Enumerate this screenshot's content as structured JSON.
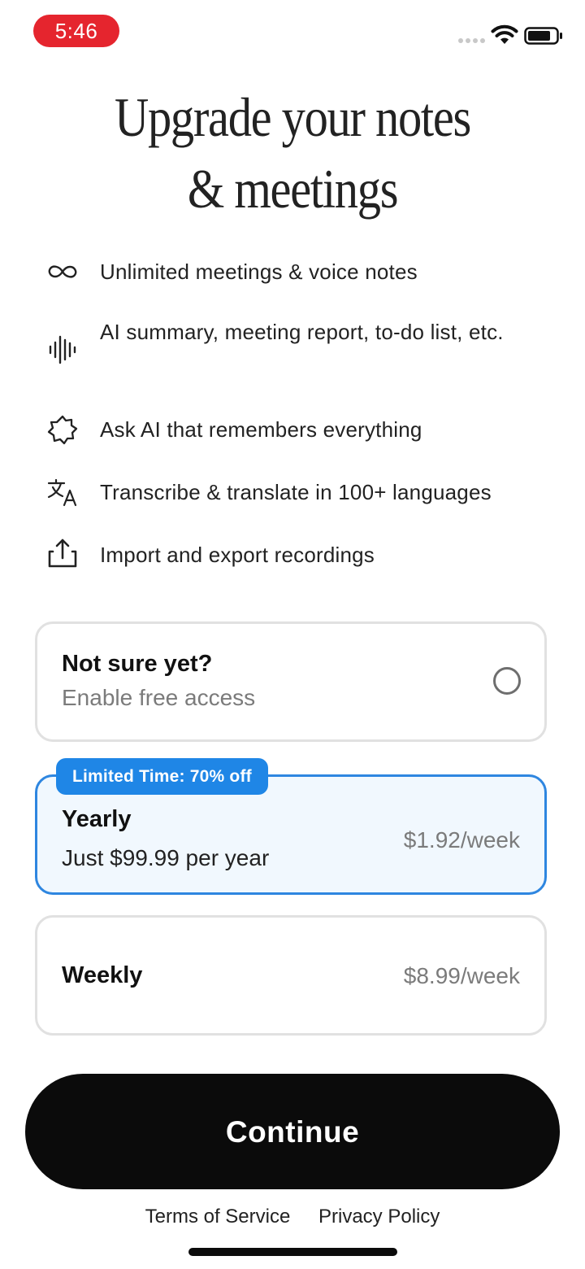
{
  "status_bar": {
    "time": "5:46"
  },
  "header": {
    "title_line1": "Upgrade your notes",
    "title_line2": "& meetings"
  },
  "features": [
    {
      "icon": "infinity-icon",
      "text": "Unlimited meetings & voice notes"
    },
    {
      "icon": "waveform-icon",
      "text": "AI summary, meeting report, to-do list, etc."
    },
    {
      "icon": "sparkle-badge-icon",
      "text": "Ask AI that remembers everything"
    },
    {
      "icon": "translate-icon",
      "text": "Transcribe & translate in 100+ languages"
    },
    {
      "icon": "share-upload-icon",
      "text": "Import and export recordings"
    }
  ],
  "plans": {
    "free": {
      "title": "Not sure yet?",
      "subtitle": "Enable free access",
      "selected": false
    },
    "yearly": {
      "badge": "Limited Time: 70% off",
      "title": "Yearly",
      "subtitle": "Just $99.99 per year",
      "price": "$1.92/week",
      "selected": true
    },
    "weekly": {
      "title": "Weekly",
      "price": "$8.99/week",
      "selected": false
    }
  },
  "continue_label": "Continue",
  "footer": {
    "terms": "Terms of Service",
    "privacy": "Privacy Policy"
  },
  "colors": {
    "status_time_bg": "#e5252e",
    "accent_blue": "#1f86e6",
    "selected_bg": "#f1f8fe",
    "button_bg": "#0b0b0b"
  }
}
